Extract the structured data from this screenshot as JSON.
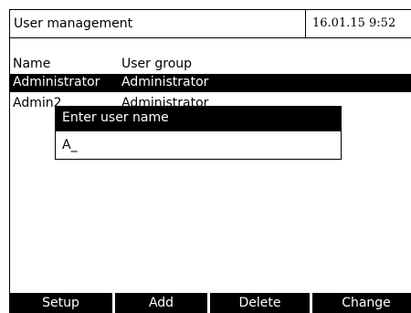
{
  "header": {
    "title": "User management",
    "datetime": "16.01.15  9:52"
  },
  "table": {
    "columns": [
      "Name",
      "User group"
    ],
    "rows": [
      {
        "name": "Administrator",
        "group": "Administrator",
        "selected": true
      },
      {
        "name": "Admin2",
        "group": "Administrator",
        "selected": false
      }
    ]
  },
  "dialog": {
    "title": "Enter user name",
    "value": "A_"
  },
  "softkeys": {
    "setup": "Setup",
    "add": "Add",
    "delete": "Delete",
    "change": "Change"
  },
  "colors": {
    "background": "#ffffff",
    "foreground": "#000000",
    "highlight": "#000000",
    "highlight_text": "#ffffff"
  }
}
